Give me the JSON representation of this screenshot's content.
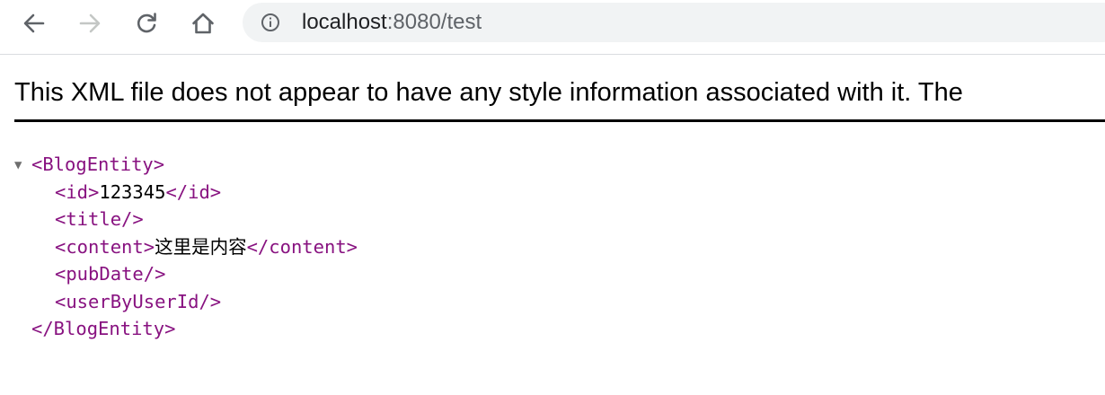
{
  "toolbar": {
    "back_icon": "arrow-left-icon",
    "forward_icon": "arrow-right-icon",
    "reload_icon": "reload-icon",
    "home_icon": "home-icon",
    "info_icon": "info-icon",
    "url_host": "localhost",
    "url_rest": ":8080/test"
  },
  "page": {
    "notice": "This XML file does not appear to have any style information associated with it. The"
  },
  "xml": {
    "root_open": "<BlogEntity>",
    "root_close": "</BlogEntity>",
    "id_open": "<id>",
    "id_value": "123345",
    "id_close": "</id>",
    "title": "<title/>",
    "content_open": "<content>",
    "content_value": "这里是内容",
    "content_close": "</content>",
    "pubdate": "<pubDate/>",
    "userbyuserid": "<userByUserId/>",
    "collapse_glyph": "▼"
  },
  "colors": {
    "tag": "#881280",
    "omnibox_bg": "#f1f3f4"
  }
}
